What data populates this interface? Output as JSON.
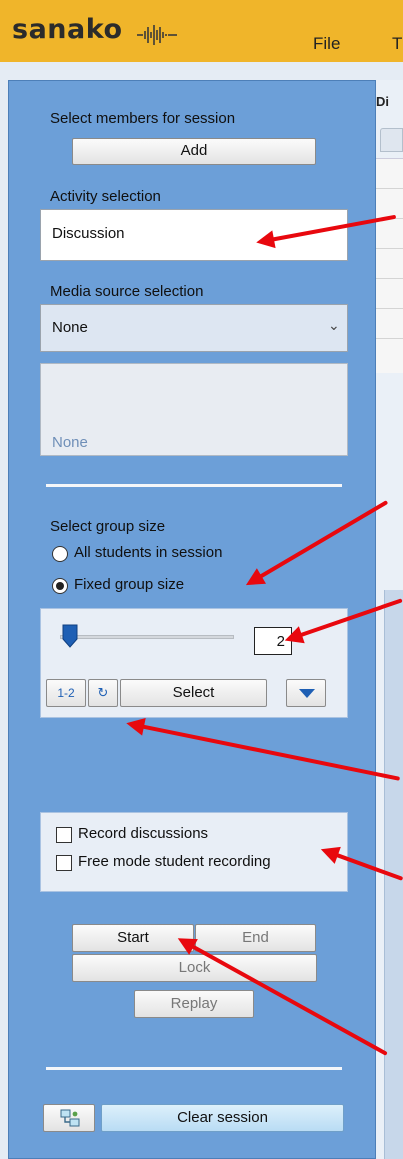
{
  "app": {
    "logo": "sanako",
    "menu_file": "File",
    "menu_next": "T"
  },
  "right": {
    "header": "Di"
  },
  "session": {
    "select_members_label": "Select members for session",
    "add_button": "Add"
  },
  "activity": {
    "label": "Activity selection",
    "value": "Discussion"
  },
  "media": {
    "label": "Media source selection",
    "value": "None",
    "preview_text": "None"
  },
  "group_size": {
    "label": "Select group size",
    "option_all": "All students in session",
    "option_fixed": "Fixed group size",
    "selected": "Fixed group size",
    "size_value": "2",
    "btn_numbering": "1-2",
    "btn_shuffle_icon": "shuffle-icon",
    "btn_select": "Select",
    "btn_dropdown_icon": "triangle-down-icon"
  },
  "recording": {
    "record_discussions": "Record discussions",
    "free_mode": "Free mode student recording"
  },
  "controls": {
    "start": "Start",
    "end": "End",
    "lock": "Lock",
    "replay": "Replay"
  },
  "footer": {
    "clear_session": "Clear session",
    "settings_icon": "network-settings-icon"
  },
  "colors": {
    "brand": "#f0b52a",
    "panel": "#6c9fd8",
    "arrow": "#e8080e"
  }
}
